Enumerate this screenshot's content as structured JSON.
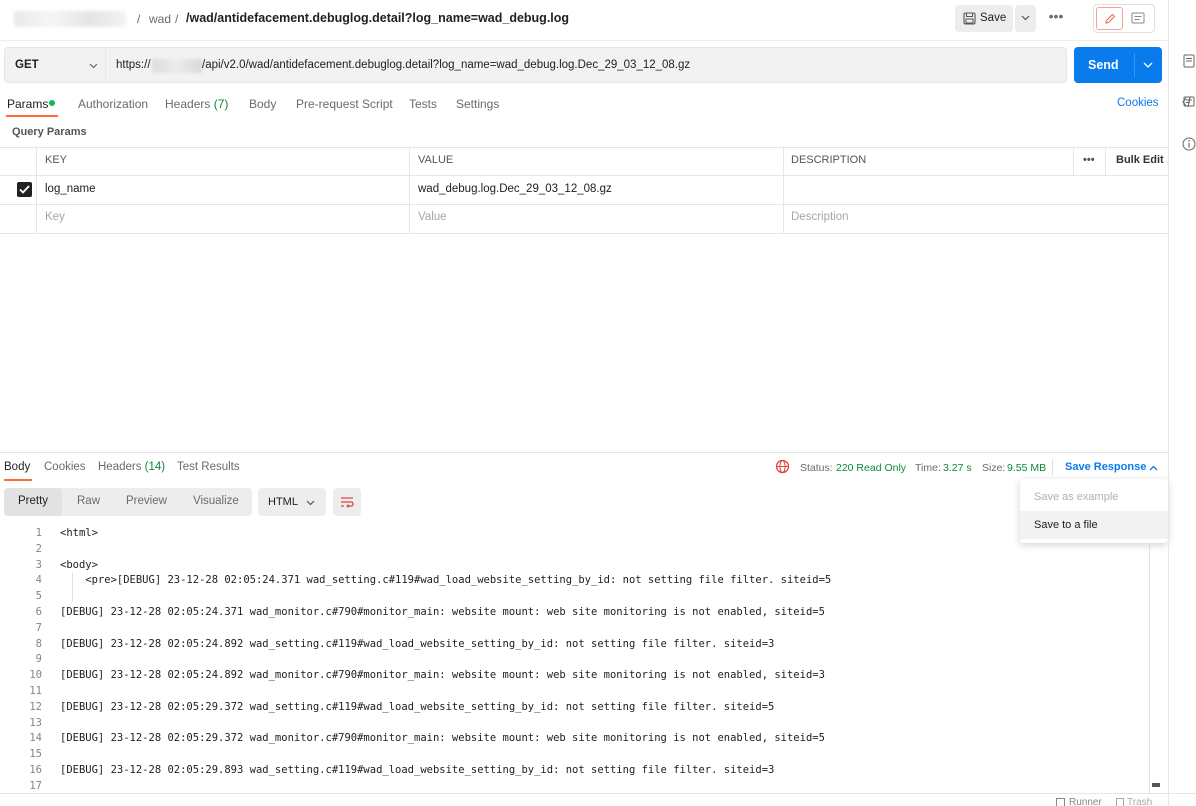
{
  "breadcrumb": {
    "workspace": "",
    "collection": "wad",
    "separator": "/",
    "request_name": "/wad/antidefacement.debuglog.detail?log_name=wad_debug.log"
  },
  "toolbar": {
    "save_label": "Save",
    "more_label": "•••"
  },
  "request": {
    "method": "GET",
    "url_prefix": "https://",
    "url_suffix": "/api/v2.0/wad/antidefacement.debuglog.detail?log_name=wad_debug.log.Dec_29_03_12_08.gz",
    "send_label": "Send"
  },
  "request_tabs": {
    "params": "Params",
    "authorization": "Authorization",
    "headers": "Headers",
    "headers_count": "(7)",
    "body": "Body",
    "pre_request": "Pre-request Script",
    "tests": "Tests",
    "settings": "Settings",
    "cookies": "Cookies"
  },
  "query_params": {
    "title": "Query Params",
    "columns": {
      "key": "KEY",
      "value": "VALUE",
      "description": "DESCRIPTION",
      "more": "•••",
      "bulk_edit": "Bulk Edit"
    },
    "rows": [
      {
        "checked": true,
        "key": "log_name",
        "value": "wad_debug.log.Dec_29_03_12_08.gz",
        "description": ""
      }
    ],
    "placeholders": {
      "key": "Key",
      "value": "Value",
      "description": "Description"
    }
  },
  "response": {
    "tabs": {
      "body": "Body",
      "cookies": "Cookies",
      "headers": "Headers",
      "headers_count": "(14)",
      "test_results": "Test Results"
    },
    "status_label": "Status:",
    "status_value": "220 Read Only",
    "time_label": "Time:",
    "time_value": "3.27 s",
    "size_label": "Size:",
    "size_value": "9.55 MB",
    "save_response": "Save Response",
    "view_modes": {
      "pretty": "Pretty",
      "raw": "Raw",
      "preview": "Preview",
      "visualize": "Visualize"
    },
    "format": "HTML",
    "dropdown": {
      "save_as_example": "Save as example",
      "save_to_file": "Save to a file"
    },
    "code_lines": [
      {
        "n": "1",
        "text": "<html>"
      },
      {
        "n": "2",
        "text": ""
      },
      {
        "n": "3",
        "text": "<body>"
      },
      {
        "n": "4",
        "text": "    <pre>[DEBUG] 23-12-28 02:05:24.371 wad_setting.c#119#wad_load_website_setting_by_id: not setting file filter. siteid=5"
      },
      {
        "n": "5",
        "text": ""
      },
      {
        "n": "6",
        "text": "[DEBUG] 23-12-28 02:05:24.371 wad_monitor.c#790#monitor_main: website mount: web site monitoring is not enabled, siteid=5"
      },
      {
        "n": "7",
        "text": ""
      },
      {
        "n": "8",
        "text": "[DEBUG] 23-12-28 02:05:24.892 wad_setting.c#119#wad_load_website_setting_by_id: not setting file filter. siteid=3"
      },
      {
        "n": "9",
        "text": ""
      },
      {
        "n": "10",
        "text": "[DEBUG] 23-12-28 02:05:24.892 wad_monitor.c#790#monitor_main: website mount: web site monitoring is not enabled, siteid=3"
      },
      {
        "n": "11",
        "text": ""
      },
      {
        "n": "12",
        "text": "[DEBUG] 23-12-28 02:05:29.372 wad_setting.c#119#wad_load_website_setting_by_id: not setting file filter. siteid=5"
      },
      {
        "n": "13",
        "text": ""
      },
      {
        "n": "14",
        "text": "[DEBUG] 23-12-28 02:05:29.372 wad_monitor.c#790#monitor_main: website mount: web site monitoring is not enabled, siteid=5"
      },
      {
        "n": "15",
        "text": ""
      },
      {
        "n": "16",
        "text": "[DEBUG] 23-12-28 02:05:29.893 wad_setting.c#119#wad_load_website_setting_by_id: not setting file filter. siteid=3"
      },
      {
        "n": "17",
        "text": ""
      }
    ]
  },
  "footer": {
    "runner": "Runner",
    "trash": "Trash"
  },
  "colors": {
    "accent": "#ff6c37",
    "send": "#097bed",
    "status_ok": "#0b8a36",
    "link": "#097bed",
    "params_dot": "#0cbb52"
  },
  "icons": [
    "save-icon",
    "chevron-down-icon",
    "more-icon",
    "pencil-icon",
    "comment-icon",
    "globe-icon",
    "wrap-icon",
    "documentation-icon",
    "code-icon",
    "info-icon",
    "runner-icon",
    "trash-icon",
    "checkbox-icon"
  ]
}
